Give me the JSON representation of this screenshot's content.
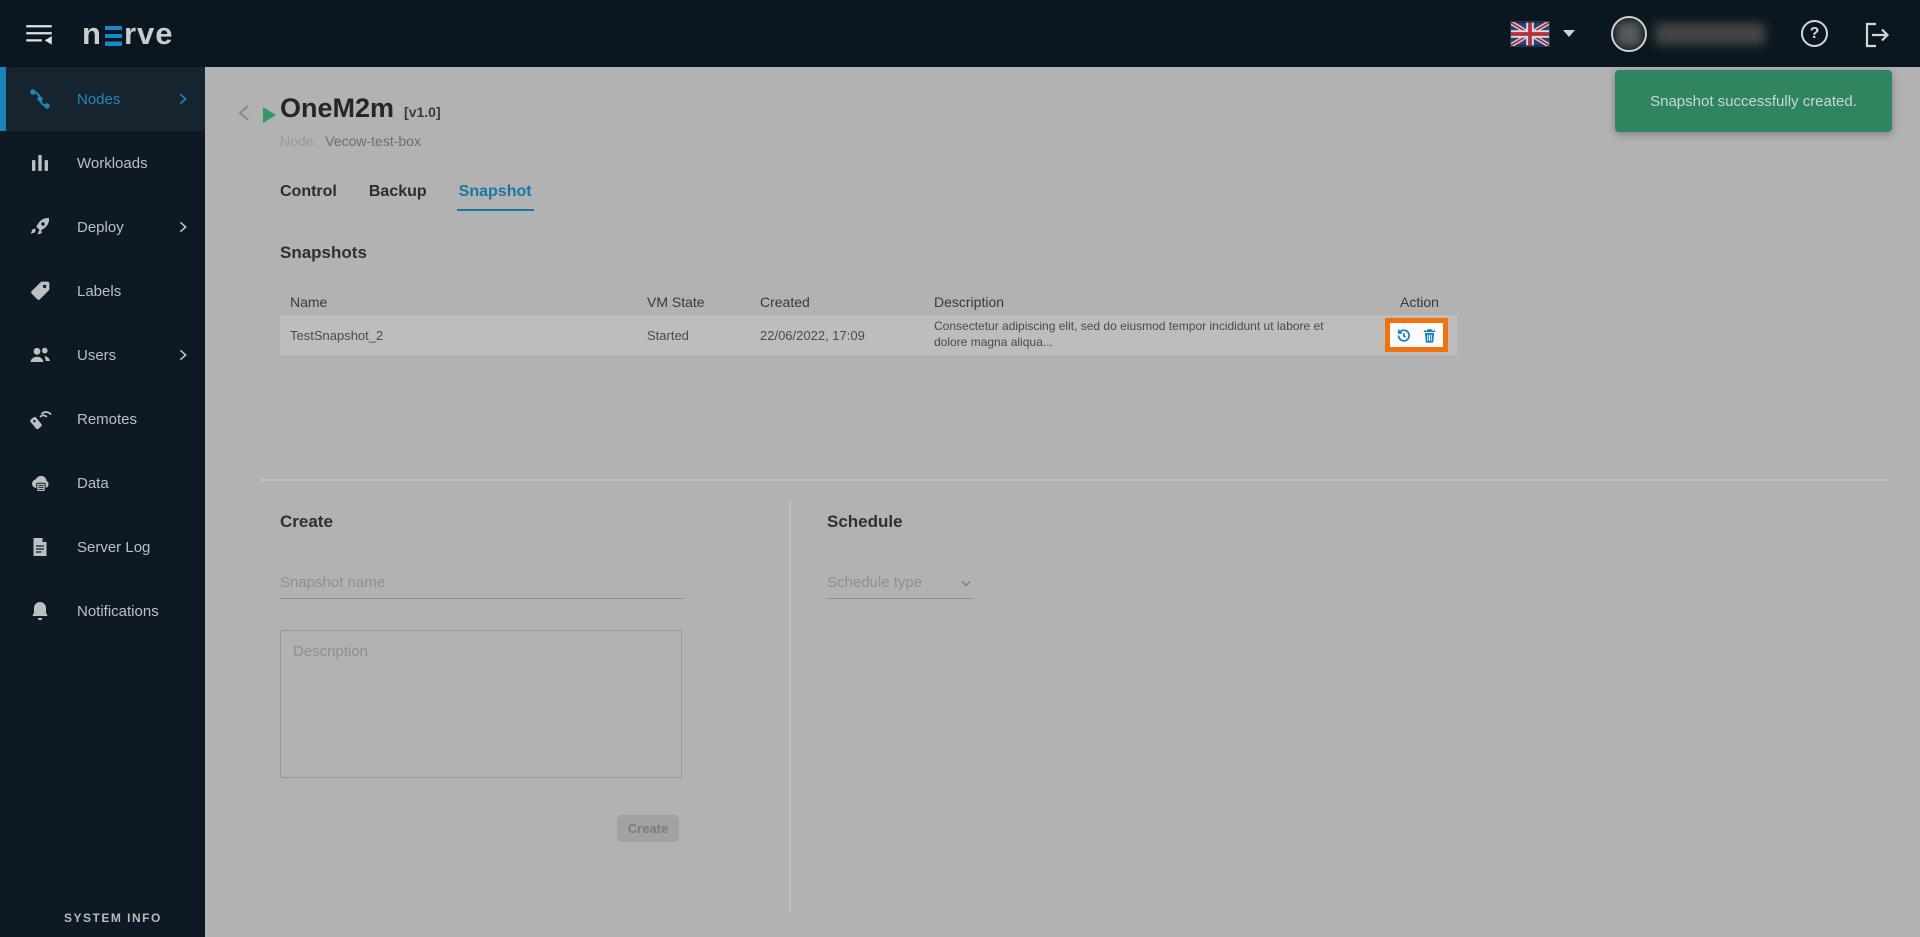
{
  "topbar": {
    "brand_prefix": "n",
    "brand_suffix": "rve",
    "icons": [
      "menu-collapse-icon",
      "uk-flag-icon",
      "caret-down-icon",
      "user-avatar",
      "help-icon",
      "logout-icon"
    ]
  },
  "sidebar": {
    "items": [
      {
        "label": "Nodes",
        "icon": "nodes-icon",
        "active": true,
        "has_chevron": true
      },
      {
        "label": "Workloads",
        "icon": "workloads-icon",
        "active": false,
        "has_chevron": false
      },
      {
        "label": "Deploy",
        "icon": "deploy-icon",
        "active": false,
        "has_chevron": true
      },
      {
        "label": "Labels",
        "icon": "labels-icon",
        "active": false,
        "has_chevron": false
      },
      {
        "label": "Users",
        "icon": "users-icon",
        "active": false,
        "has_chevron": true
      },
      {
        "label": "Remotes",
        "icon": "remotes-icon",
        "active": false,
        "has_chevron": false
      },
      {
        "label": "Data",
        "icon": "data-icon",
        "active": false,
        "has_chevron": false
      },
      {
        "label": "Server Log",
        "icon": "server-log-icon",
        "active": false,
        "has_chevron": false
      },
      {
        "label": "Notifications",
        "icon": "notifications-icon",
        "active": false,
        "has_chevron": false
      }
    ],
    "footer": "SYSTEM INFO"
  },
  "toast": {
    "message": "Snapshot successfully created."
  },
  "page": {
    "title": "OneM2m",
    "version": "[v1.0]",
    "node_label": "Node:",
    "node_value": "Vecow-test-box",
    "tabs": [
      {
        "label": "Control",
        "active": false
      },
      {
        "label": "Backup",
        "active": false
      },
      {
        "label": "Snapshot",
        "active": true
      }
    ]
  },
  "snapshots": {
    "heading": "Snapshots",
    "columns": [
      "Name",
      "VM State",
      "Created",
      "Description",
      "Action"
    ],
    "rows": [
      {
        "name": "TestSnapshot_2",
        "vm_state": "Started",
        "created": "22/06/2022, 17:09",
        "description": "Consectetur adipiscing elit, sed do eiusmod tempor incididunt ut labore et dolore magna aliqua...",
        "actions": [
          "restore-snapshot-icon",
          "delete-snapshot-icon"
        ]
      }
    ]
  },
  "create": {
    "heading": "Create",
    "name_placeholder": "Snapshot name",
    "description_placeholder": "Description",
    "button_label": "Create"
  },
  "schedule": {
    "heading": "Schedule",
    "type_placeholder": "Schedule type"
  },
  "colors": {
    "accent_blue": "#1b85b8",
    "toast_green": "#2e8560",
    "highlight_orange": "#f2730d",
    "action_icon_blue": "#157fc0",
    "play_green": "#2f9a66"
  }
}
